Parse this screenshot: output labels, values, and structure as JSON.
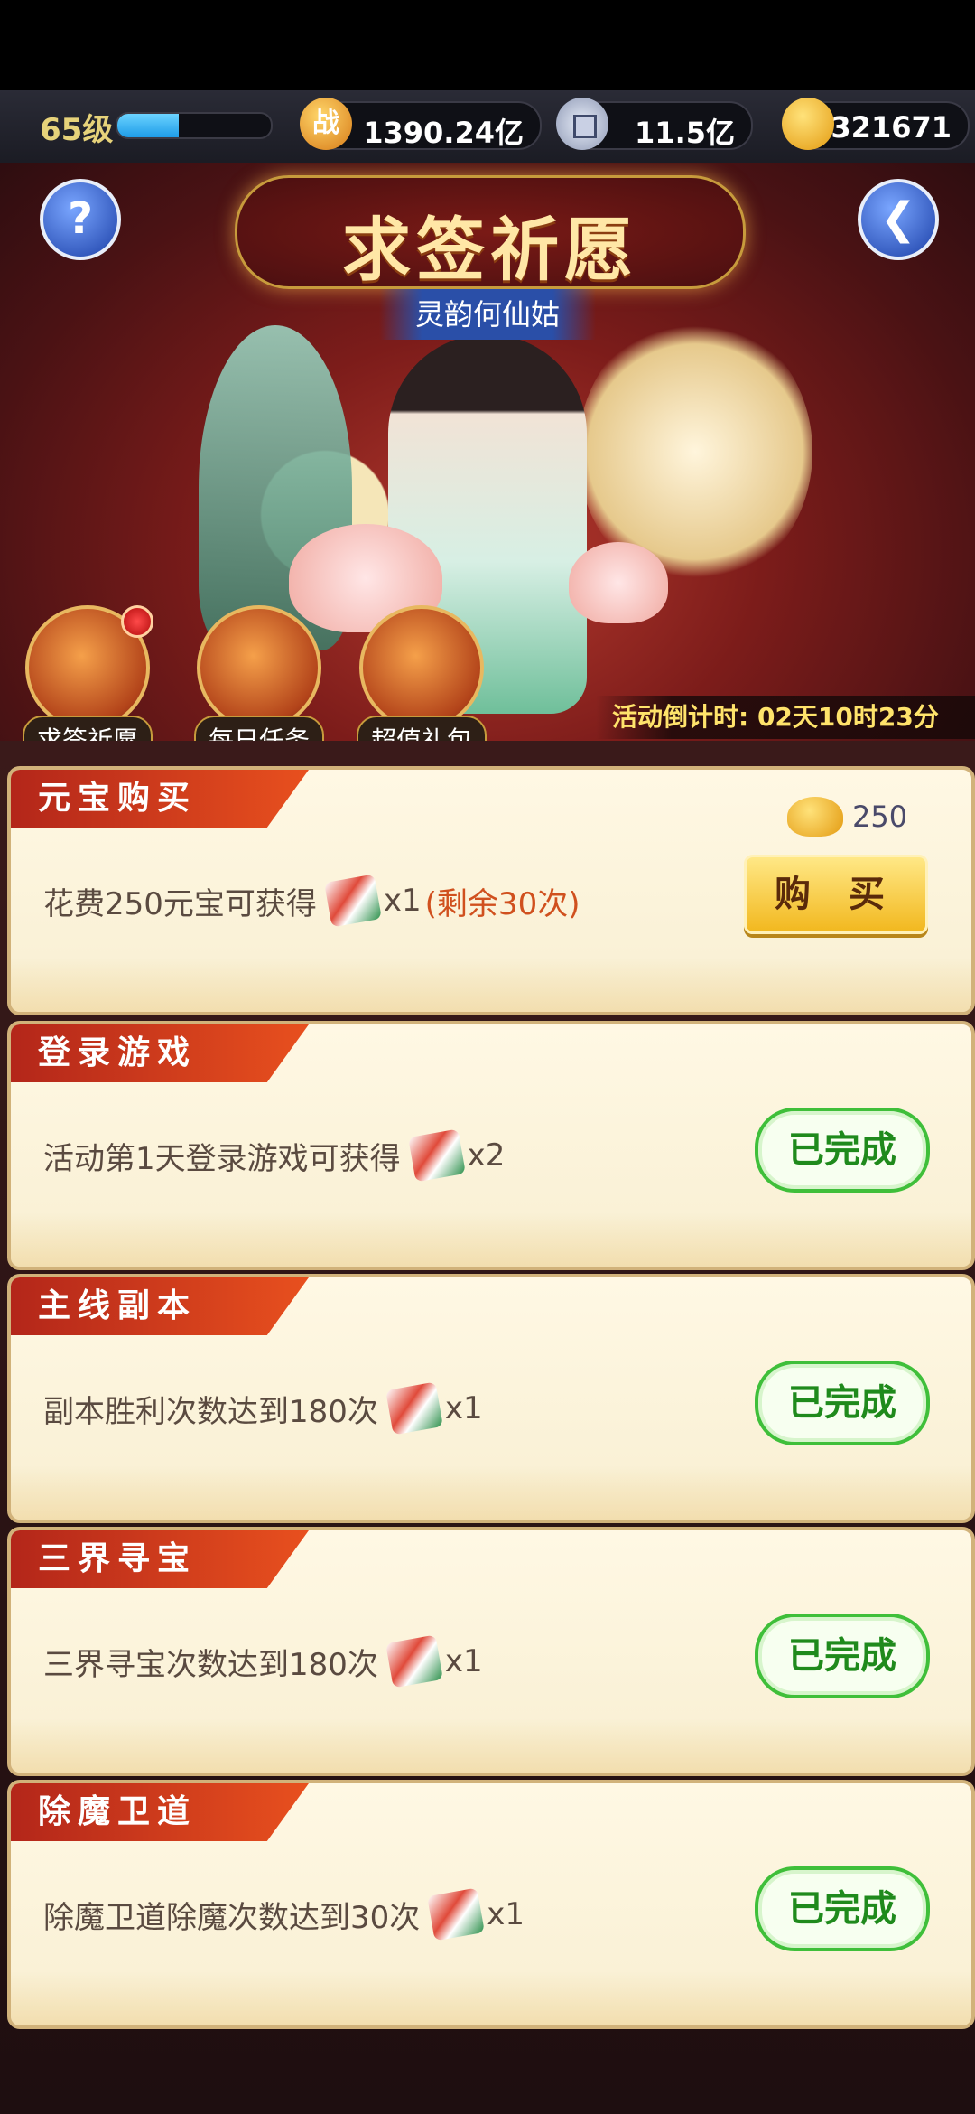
{
  "resources": {
    "level": "65级",
    "level_progress": 0.4,
    "power_icon_glyph": "战",
    "power": "1390.24亿",
    "silver": "11.5亿",
    "gold": "321671"
  },
  "header": {
    "title": "求签祈愿",
    "hero_name": "灵韵何仙姑",
    "help_glyph": "?",
    "back_glyph": "❮"
  },
  "tabs": [
    {
      "label": "求签祈愿"
    },
    {
      "label": "每日任务"
    },
    {
      "label": "超值礼包"
    }
  ],
  "countdown": "活动倒计时: 02天10时23分",
  "tasks": [
    {
      "tag": "元宝购买",
      "desc": "花费250元宝可获得",
      "qty": "x1",
      "remain": "(剩余30次)",
      "price": "250",
      "button": "购 买"
    },
    {
      "tag": "登录游戏",
      "desc": "活动第1天登录游戏可获得",
      "qty": "x2",
      "button": "已完成"
    },
    {
      "tag": "主线副本",
      "desc": "副本胜利次数达到180次",
      "qty": "x1",
      "button": "已完成"
    },
    {
      "tag": "三界寻宝",
      "desc": "三界寻宝次数达到180次",
      "qty": "x1",
      "button": "已完成"
    },
    {
      "tag": "除魔卫道",
      "desc": "除魔卫道除魔次数达到30次",
      "qty": "x1",
      "button": "已完成"
    }
  ],
  "colors": {
    "accent_red": "#e8501e",
    "done_green": "#3fbf3a",
    "buy_gold": "#f2b81f"
  }
}
